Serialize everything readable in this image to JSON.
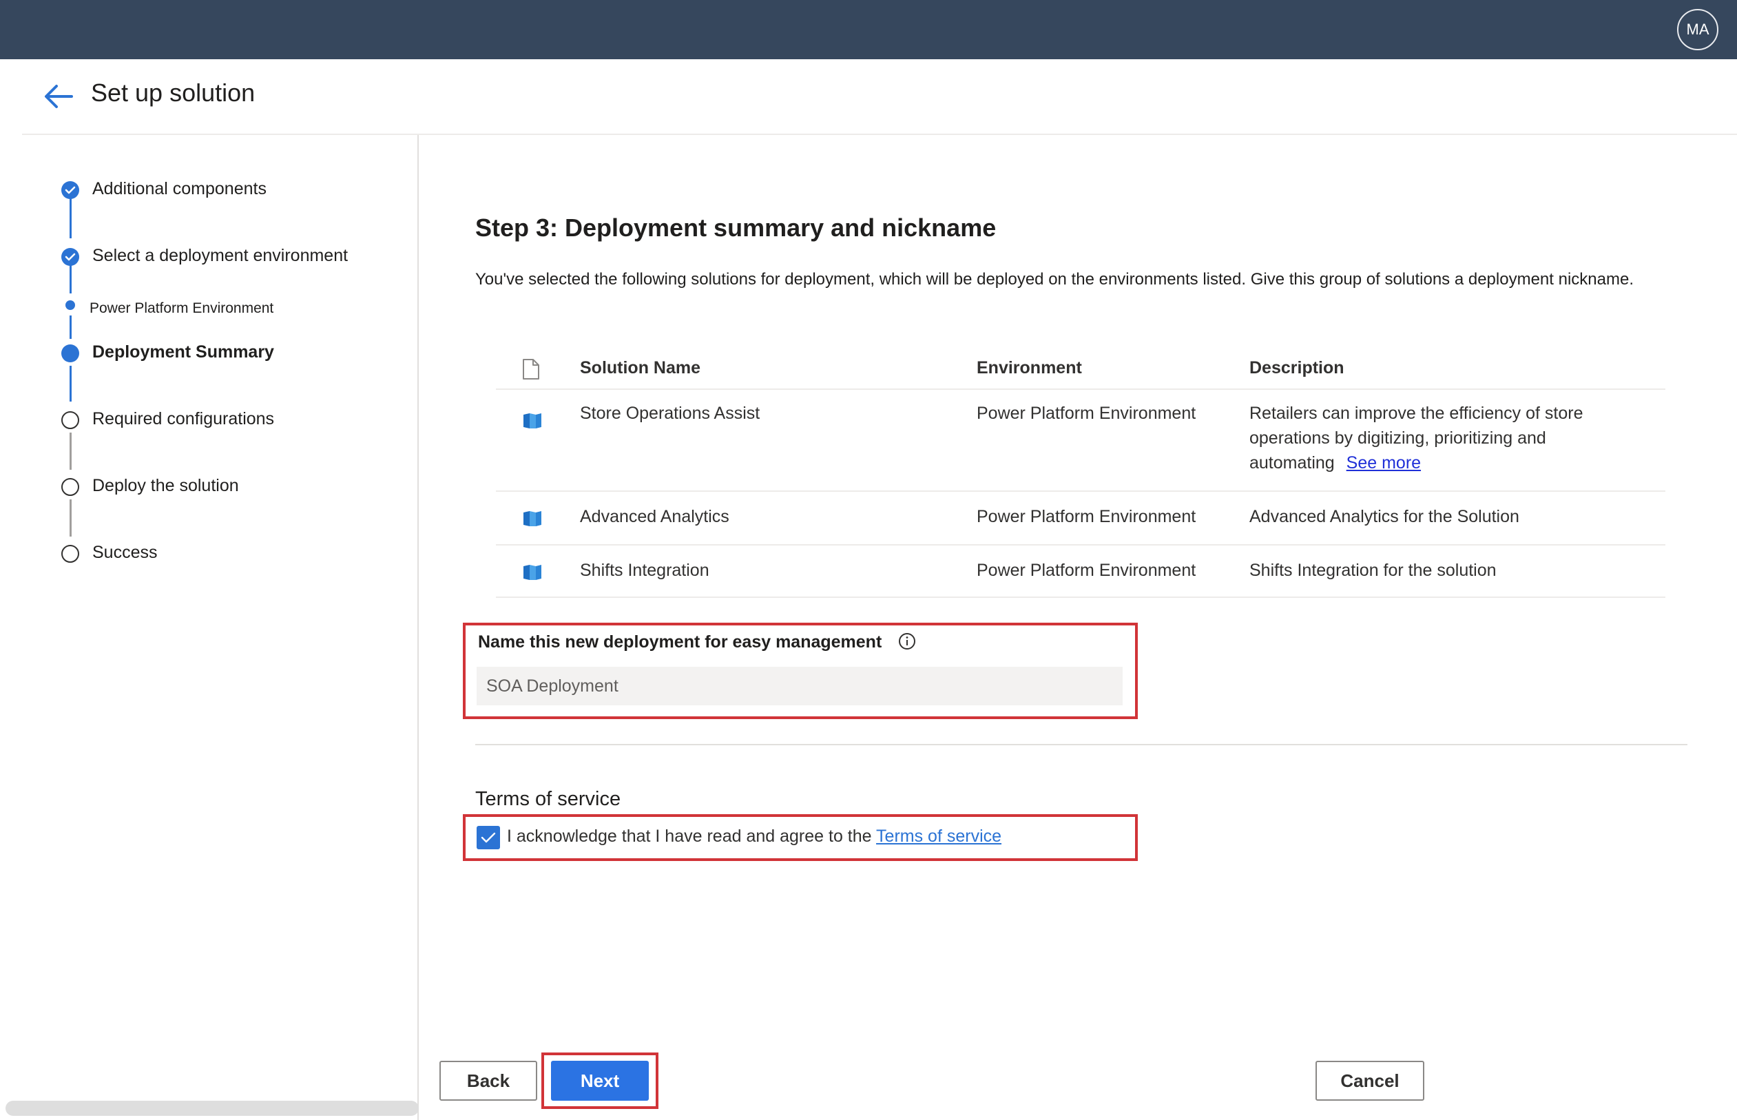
{
  "topbar": {
    "avatar_initials": "MA"
  },
  "header": {
    "title": "Set up solution"
  },
  "steps": [
    {
      "label": "Additional components",
      "status": "completed"
    },
    {
      "label": "Select a deployment environment",
      "status": "completed"
    },
    {
      "label": "Power Platform Environment",
      "status": "completed-substep"
    },
    {
      "label": "Deployment Summary",
      "status": "current"
    },
    {
      "label": "Required configurations",
      "status": "pending"
    },
    {
      "label": "Deploy the solution",
      "status": "pending"
    },
    {
      "label": "Success",
      "status": "pending"
    }
  ],
  "main": {
    "heading": "Step 3: Deployment summary and nickname",
    "intro": "You've selected the following solutions for deployment, which will be deployed on the environments listed. Give this group of solutions a deployment nickname.",
    "table": {
      "columns": [
        "Solution Name",
        "Environment",
        "Description"
      ],
      "rows": [
        {
          "name": "Store Operations Assist",
          "environment": "Power Platform Environment",
          "description": "Retailers can improve the efficiency of store operations by digitizing, prioritizing and automating",
          "link": "See more"
        },
        {
          "name": "Advanced Analytics",
          "environment": "Power Platform Environment",
          "description": "Advanced Analytics for the Solution"
        },
        {
          "name": "Shifts Integration",
          "environment": "Power Platform Environment",
          "description": "Shifts Integration for the solution"
        }
      ]
    },
    "nickname": {
      "label": "Name this new deployment for easy management",
      "value": "SOA Deployment"
    },
    "terms": {
      "title": "Terms of service",
      "text": "I acknowledge that I have read and agree to the ",
      "link": "Terms of service",
      "checked": true
    }
  },
  "footer": {
    "back": "Back",
    "next": "Next",
    "cancel": "Cancel"
  },
  "colors": {
    "topbar": "#36475d",
    "accent": "#2b73d4",
    "highlight": "#d13438"
  }
}
